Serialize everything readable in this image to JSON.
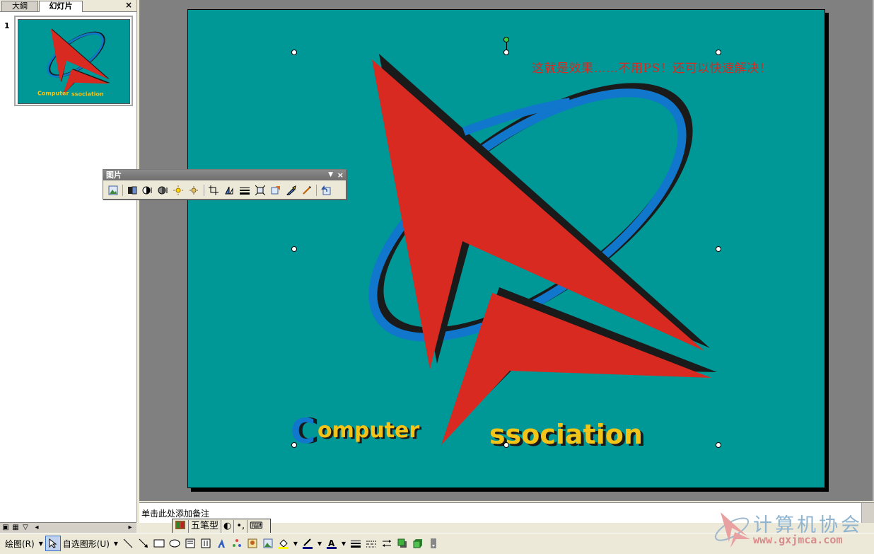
{
  "left_pane": {
    "tab_outline": "大綱",
    "tab_slides": "幻灯片",
    "close": "×",
    "slide_number": "1"
  },
  "slide": {
    "caption": "这就是效果……不用PS！还可以快速解决！",
    "logo_word_left": "omputer",
    "logo_word_right": "ssociation",
    "logo_initial": "C",
    "colors": {
      "background": "#009797",
      "red": "#d82a20",
      "blue": "#1177cc",
      "yellow": "#f2c418",
      "shadow": "#1a1a1a"
    }
  },
  "picture_toolbar": {
    "title": "图片",
    "menu_arrow": "▼",
    "close": "×",
    "buttons": [
      "insert-picture",
      "color",
      "more-contrast",
      "less-contrast",
      "more-brightness",
      "less-brightness",
      "crop",
      "rotate-left",
      "line-style",
      "compress-pictures",
      "format-picture",
      "set-transparent-color",
      "reset-picture"
    ]
  },
  "notes": {
    "placeholder": "单击此处添加备注"
  },
  "ime": {
    "label": "五笔型",
    "moon": "◐",
    "punct": "•,",
    "keyboard": "⌨"
  },
  "drawing_toolbar": {
    "draw_menu": "绘图(R)",
    "autoshapes_menu": "自选图形(U)",
    "arrow": "▾"
  },
  "watermark": {
    "title": "计算机协会",
    "url": "www.gxjmca.com"
  }
}
